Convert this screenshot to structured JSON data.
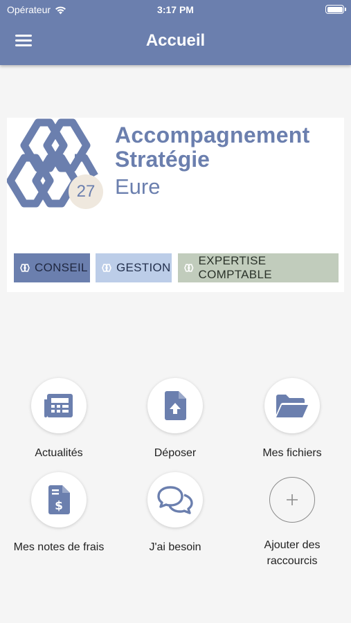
{
  "status_bar": {
    "carrier": "Opérateur",
    "time": "3:17 PM"
  },
  "header": {
    "title": "Accueil",
    "menu_icon": "hamburger-icon"
  },
  "brand": {
    "line1": "Accompagnement",
    "line2": "Stratégie",
    "line3": "Eure",
    "badge": "27",
    "tags": [
      {
        "label": "CONSEIL",
        "color": "#6b7fae"
      },
      {
        "label": "GESTION",
        "color": "#bccde8"
      },
      {
        "label": "EXPERTISE COMPTABLE",
        "color": "#c1ccbc"
      }
    ]
  },
  "shortcuts": [
    {
      "label": "Actualités",
      "icon": "newspaper-icon"
    },
    {
      "label": "Déposer",
      "icon": "file-upload-icon"
    },
    {
      "label": "Mes fichiers",
      "icon": "folder-icon"
    },
    {
      "label": "Mes notes de frais",
      "icon": "invoice-dollar-icon"
    },
    {
      "label": "J'ai besoin",
      "icon": "chat-bubbles-icon"
    },
    {
      "label": "Ajouter des raccourcis",
      "icon": "plus-icon"
    }
  ],
  "colors": {
    "accent": "#6b7fae",
    "background": "#f5f5f5"
  }
}
